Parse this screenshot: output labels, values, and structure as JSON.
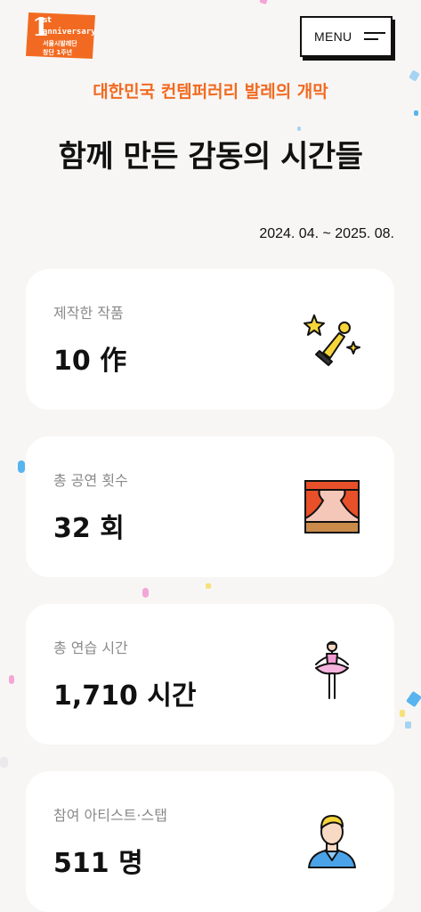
{
  "logo": {
    "line1": "st",
    "line2": "anniversary",
    "line3": "서울시발레단",
    "line4": "창단 1주년",
    "color": "#f26a21"
  },
  "menu": {
    "label": "MENU"
  },
  "subtitle": "대한민국 컨템퍼러리 발레의 개막",
  "title": "함께 만든 감동의 시간들",
  "period": "2024. 04. ~ 2025. 08.",
  "stats": [
    {
      "label": "제작한 작품",
      "value": "10 作",
      "icon": "trophy-icon"
    },
    {
      "label": "총 공연 횟수",
      "value": "32 회",
      "icon": "stage-curtain-icon"
    },
    {
      "label": "총 연습 시간",
      "value": "1,710 시간",
      "icon": "ballerina-icon"
    },
    {
      "label": "참여 아티스트·스탭",
      "value": "511 명",
      "icon": "artist-icon"
    }
  ]
}
